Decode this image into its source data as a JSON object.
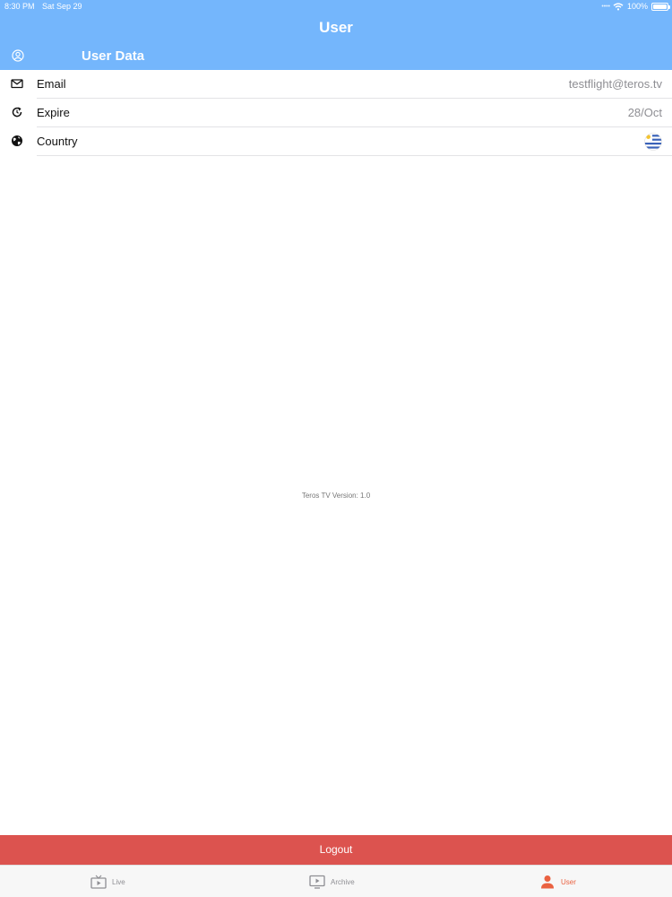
{
  "status_bar": {
    "time": "8:30 PM",
    "date": "Sat Sep 29",
    "battery": "100%",
    "battery_level": 1.0,
    "icons": [
      "wifi-icon",
      "battery-icon"
    ]
  },
  "nav": {
    "title": "User"
  },
  "section": {
    "title": "User Data",
    "icon": "user-circle-icon"
  },
  "rows": [
    {
      "label": "Email",
      "value": "testflight@teros.tv",
      "icon": "envelope-icon"
    },
    {
      "label": "Expire",
      "value": "28/Oct",
      "icon": "refresh-icon"
    },
    {
      "label": "Country",
      "value": "",
      "icon": "globe-icon",
      "flag": "uruguay-flag-icon"
    }
  ],
  "footer": {
    "version_text": "Teros TV Version: 1.0"
  },
  "logout": {
    "label": "Logout"
  },
  "tabs": [
    {
      "label": "Live",
      "icon": "tv-icon",
      "active": false
    },
    {
      "label": "Archive",
      "icon": "play-screen-icon",
      "active": false
    },
    {
      "label": "User",
      "icon": "person-icon",
      "active": true
    }
  ],
  "colors": {
    "header": "#74b6fc",
    "logout": "#dc534f",
    "active_tab": "#ea6140",
    "inactive_tab": "#8e8e93"
  }
}
